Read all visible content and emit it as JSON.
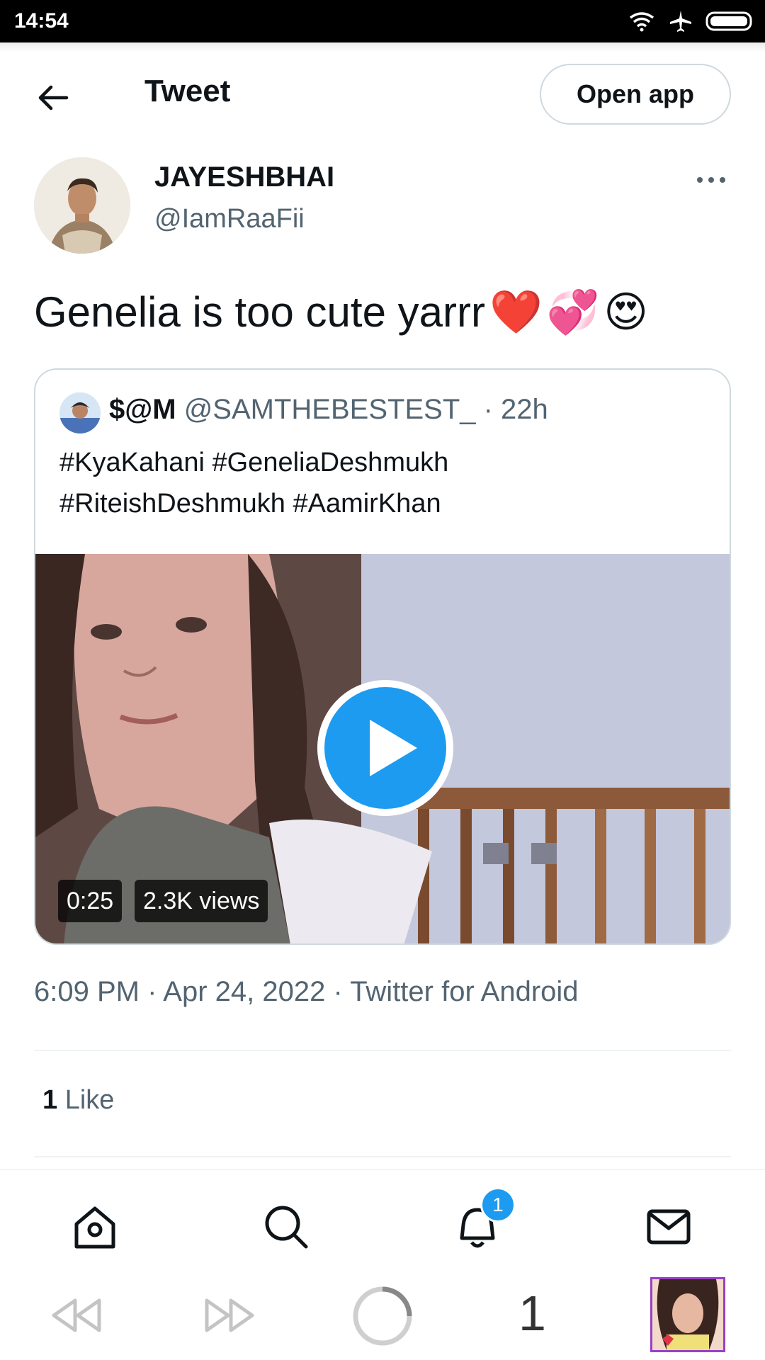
{
  "status_bar": {
    "time": "14:54"
  },
  "header": {
    "title": "Tweet",
    "open_app_label": "Open app"
  },
  "tweet": {
    "author_name": "JAYESHBHAI",
    "author_handle": "@IamRaaFii",
    "text": "Genelia is too cute yarrr",
    "emojis": [
      "❤️",
      "💞",
      "😍"
    ],
    "timestamp": "6:09 PM · Apr 24, 2022 · Twitter for Android",
    "like_count": "1",
    "like_label": "Like"
  },
  "quote": {
    "name": "$@M",
    "handle": "@SAMTHEBESTEST_",
    "age": "· 22h",
    "line1": "#KyaKahani #GeneliaDeshmukh",
    "line2": "#RiteishDeshmukh #AamirKhan",
    "video_duration": "0:25",
    "video_views": "2.3K views"
  },
  "bottom_nav": {
    "items": [
      "home-icon",
      "search-icon",
      "bell-icon",
      "mail-icon"
    ],
    "notification_count": "1"
  },
  "system_nav": {
    "tab_count": "1"
  },
  "colors": {
    "accent": "#1d9bf0",
    "muted": "#536471",
    "border": "#cfd9de"
  }
}
